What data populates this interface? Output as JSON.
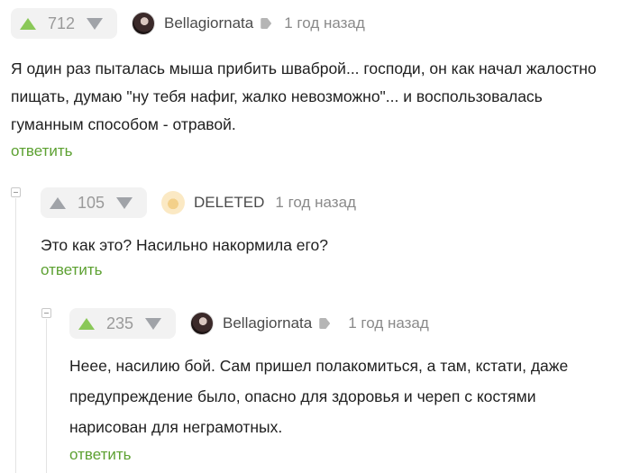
{
  "comments": [
    {
      "score": "712",
      "author": "Bellagiornata",
      "time": "1 год назад",
      "text": "Я один раз пыталась мыша прибить шваброй... господи, он как начал жалостно пищать, думаю \"ну тебя нафиг, жалко невозможно\"... и воспользовалась гуманным способом - отравой.",
      "reply": "ответить"
    },
    {
      "score": "105",
      "author": "DELETED",
      "time": "1 год назад",
      "text": "Это как это? Насильно накормила его?",
      "reply": "ответить"
    },
    {
      "score": "235",
      "author": "Bellagiornata",
      "time": "1 год назад",
      "text": "Неее, насилию бой. Сам пришел полакомиться, а там, кстати, даже предупреждение было, опасно для здоровья и череп с костями нарисован для неграмотных.",
      "reply": "ответить"
    }
  ]
}
